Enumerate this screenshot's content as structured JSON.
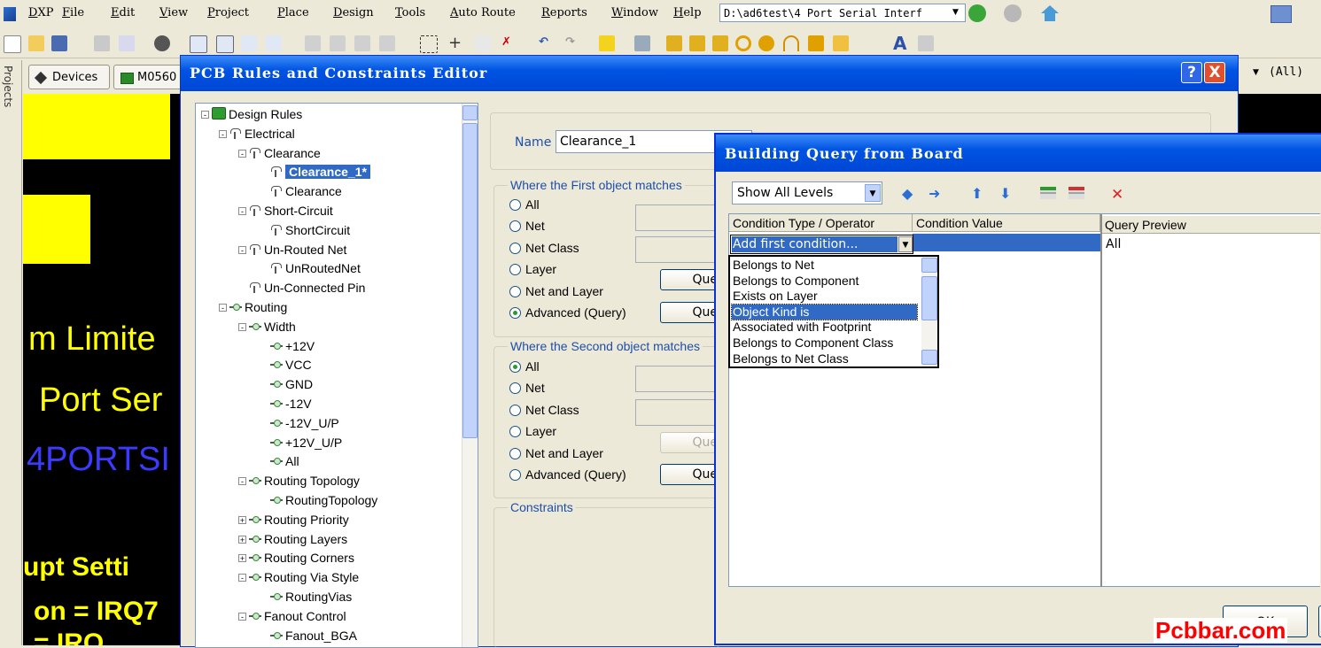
{
  "app": {
    "menu": [
      "DXP",
      "File",
      "Edit",
      "View",
      "Project",
      "Place",
      "Design",
      "Tools",
      "Auto Route",
      "Reports",
      "Window",
      "Help"
    ],
    "path": "D:\\ad6test\\4 Port Serial Interf",
    "filter_value": "(All)"
  },
  "side": {
    "projects_tab": "Projects",
    "doc_tabs": [
      "Devices",
      "M0560"
    ]
  },
  "pcb": {
    "texts": [
      "m Limite",
      "Port Ser",
      "4PORTSI",
      "upt Setti",
      "on = IRQ7",
      "= IRQ"
    ]
  },
  "editor": {
    "title": "PCB Rules and Constraints Editor",
    "help_btn": "?",
    "close_btn": "X",
    "tree": [
      {
        "label": "Design Rules",
        "level": 0,
        "icon": "design-rules-icon",
        "expander": "-"
      },
      {
        "label": "Electrical",
        "level": 1,
        "icon": "electrical-icon",
        "expander": "-"
      },
      {
        "label": "Clearance",
        "level": 2,
        "icon": "electrical-icon",
        "expander": "-"
      },
      {
        "label": "Clearance_1*",
        "level": 3,
        "icon": "electrical-icon",
        "expander": "",
        "selected": true
      },
      {
        "label": "Clearance",
        "level": 3,
        "icon": "electrical-icon",
        "expander": ""
      },
      {
        "label": "Short-Circuit",
        "level": 2,
        "icon": "electrical-icon",
        "expander": "-"
      },
      {
        "label": "ShortCircuit",
        "level": 3,
        "icon": "electrical-icon",
        "expander": ""
      },
      {
        "label": "Un-Routed Net",
        "level": 2,
        "icon": "electrical-icon",
        "expander": "-"
      },
      {
        "label": "UnRoutedNet",
        "level": 3,
        "icon": "electrical-icon",
        "expander": ""
      },
      {
        "label": "Un-Connected Pin",
        "level": 2,
        "icon": "electrical-icon",
        "expander": ""
      },
      {
        "label": "Routing",
        "level": 1,
        "icon": "routing-icon",
        "expander": "-"
      },
      {
        "label": "Width",
        "level": 2,
        "icon": "routing-icon",
        "expander": "-"
      },
      {
        "label": "+12V",
        "level": 3,
        "icon": "routing-icon",
        "expander": ""
      },
      {
        "label": "VCC",
        "level": 3,
        "icon": "routing-icon",
        "expander": ""
      },
      {
        "label": "GND",
        "level": 3,
        "icon": "routing-icon",
        "expander": ""
      },
      {
        "label": "-12V",
        "level": 3,
        "icon": "routing-icon",
        "expander": ""
      },
      {
        "label": "-12V_U/P",
        "level": 3,
        "icon": "routing-icon",
        "expander": ""
      },
      {
        "label": "+12V_U/P",
        "level": 3,
        "icon": "routing-icon",
        "expander": ""
      },
      {
        "label": "All",
        "level": 3,
        "icon": "routing-icon",
        "expander": ""
      },
      {
        "label": "Routing Topology",
        "level": 2,
        "icon": "routing-icon",
        "expander": "-"
      },
      {
        "label": "RoutingTopology",
        "level": 3,
        "icon": "routing-icon",
        "expander": ""
      },
      {
        "label": "Routing Priority",
        "level": 2,
        "icon": "routing-icon",
        "expander": "+"
      },
      {
        "label": "Routing Layers",
        "level": 2,
        "icon": "routing-icon",
        "expander": "+"
      },
      {
        "label": "Routing Corners",
        "level": 2,
        "icon": "routing-icon",
        "expander": "+"
      },
      {
        "label": "Routing Via Style",
        "level": 2,
        "icon": "routing-icon",
        "expander": "-"
      },
      {
        "label": "RoutingVias",
        "level": 3,
        "icon": "routing-icon",
        "expander": ""
      },
      {
        "label": "Fanout Control",
        "level": 2,
        "icon": "routing-icon",
        "expander": "-"
      },
      {
        "label": "Fanout_BGA",
        "level": 3,
        "icon": "routing-icon",
        "expander": ""
      }
    ],
    "name_label": "Name",
    "name_value": "Clearance_1",
    "first_group": "Where the First object matches",
    "second_group": "Where the Second object matches",
    "constraints_group": "Constraints",
    "first_options": [
      {
        "label": "All",
        "checked": false
      },
      {
        "label": "Net",
        "checked": false
      },
      {
        "label": "Net Class",
        "checked": false
      },
      {
        "label": "Layer",
        "checked": false
      },
      {
        "label": "Net and Layer",
        "checked": false
      },
      {
        "label": "Advanced (Query)",
        "checked": true
      }
    ],
    "second_options": [
      {
        "label": "All",
        "checked": true
      },
      {
        "label": "Net",
        "checked": false
      },
      {
        "label": "Net Class",
        "checked": false
      },
      {
        "label": "Layer",
        "checked": false
      },
      {
        "label": "Net and Layer",
        "checked": false
      },
      {
        "label": "Advanced (Query)",
        "checked": false
      }
    ],
    "query_btn": "Que"
  },
  "query_dialog": {
    "title": "Building Query from Board",
    "levels_value": "Show All Levels",
    "col_condition": "Condition Type / Operator",
    "col_value": "Condition Value",
    "col_preview": "Query Preview",
    "current_condition": "Add first condition...",
    "preview_text": "All",
    "options": [
      "Belongs to Net",
      "Belongs to Component",
      "Exists on Layer",
      "Object Kind is",
      "Associated with Footprint",
      "Belongs to Component Class",
      "Belongs to Net Class"
    ],
    "highlighted_option": "Object Kind is",
    "ok": "OK"
  },
  "watermark": "Pcbbar.com",
  "colors": {
    "titlebar": "#0054e3",
    "selection": "#316ac5",
    "pcb_text": "#ffff00",
    "watermark": "#ff0000"
  }
}
